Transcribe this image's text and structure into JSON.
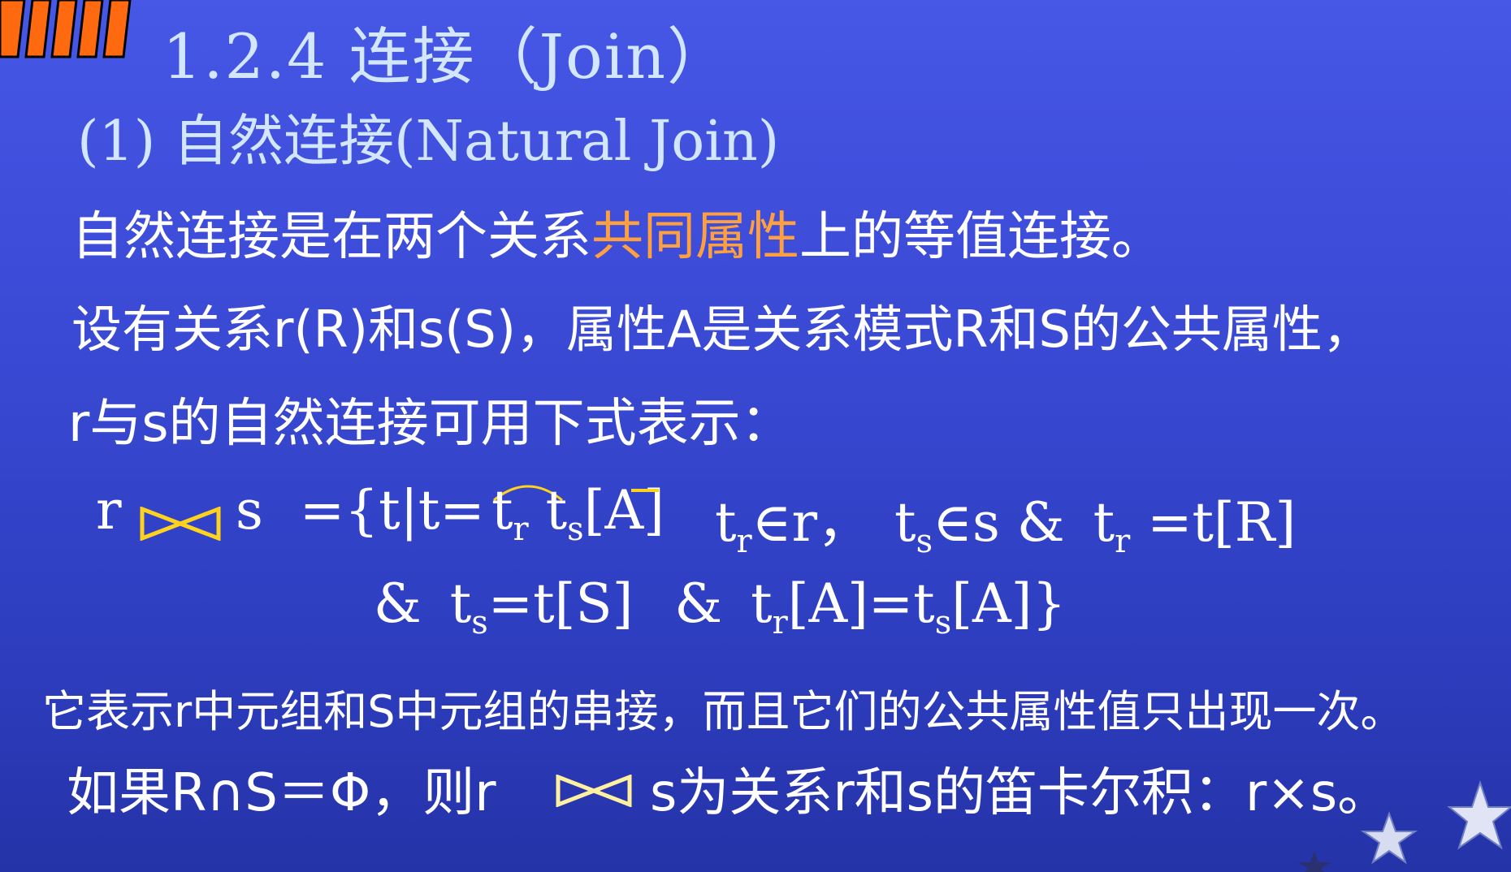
{
  "colors": {
    "background": "#3f4fdc",
    "title": "#d2e6ff",
    "text": "#ffffff",
    "highlight": "#ffa040",
    "corner": "#ff6a10",
    "join_symbol": "#ffd21e"
  },
  "title": "1.2.4 连接（Join）",
  "subtitle": "(1) 自然连接(Natural Join)",
  "para1": {
    "before": "自然连接是在两个关系",
    "highlight": "共同属性",
    "after": "上的等值连接。"
  },
  "para2": "设有关系r(R)和s(S)，属性A是关系模式R和S的公共属性，",
  "para3": "r与s的自然连接可用下式表示：",
  "formula": {
    "r": "r",
    "s": "s",
    "eq": "={t|t=",
    "t1": "t",
    "sub_r1": "r",
    "t2": "t",
    "sub_s1": "s",
    "attrA": "[A]",
    "t3": "t",
    "sub_r2": "r",
    "in_r": "∈r，",
    "t4": "t",
    "sub_s2": "s",
    "in_s": "∈s &",
    "t5": "t",
    "sub_r3": "r",
    "eq_tR": "=t[R]",
    "l2_amp": "&",
    "t6": "t",
    "sub_s3": "s",
    "eq_tS": "=t[S]",
    "l2_amp2": "&",
    "t7": "t",
    "sub_r4": "r",
    "tr_A": "[A]=t",
    "sub_s4": "s",
    "ts_A": "[A]}"
  },
  "note": "它表示r中元组和S中元组的串接，而且它们的公共属性值只出现一次。",
  "last": {
    "part1": "如果R∩S＝Φ，则r",
    "part2": "s为关系r和s的笛卡尔积：r×s。"
  },
  "icons": [
    "join-bowtie-icon",
    "star-icon"
  ]
}
